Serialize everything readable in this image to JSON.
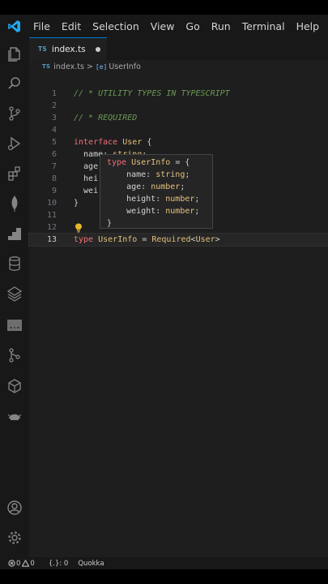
{
  "menubar": {
    "logo_icon": "vscode-logo-icon",
    "items": [
      "File",
      "Edit",
      "Selection",
      "View",
      "Go",
      "Run",
      "Terminal",
      "Help"
    ]
  },
  "activity_bar": {
    "top_icons": [
      "explorer-icon",
      "search-icon",
      "source-control-icon",
      "run-debug-icon",
      "extensions-icon",
      "mongodb-icon",
      "stairs-icon",
      "database-icon",
      "layers-icon",
      "env-icon",
      "git-graph-icon",
      "cube-icon",
      "remote-icon"
    ],
    "bottom_icons": [
      "account-icon",
      "settings-gear-icon"
    ]
  },
  "tab": {
    "badge": "TS",
    "filename": "index.ts",
    "dirty": true
  },
  "breadcrumb": {
    "badge": "TS",
    "file": "index.ts",
    "separator": ">",
    "symbol_glyph": "[e]",
    "symbol": "UserInfo"
  },
  "editor": {
    "active_line": 13,
    "lines": [
      {
        "n": "1",
        "tokens": [
          {
            "t": "// * UTILITY TYPES IN TYPESCRIPT",
            "c": "cm"
          }
        ]
      },
      {
        "n": "2",
        "tokens": []
      },
      {
        "n": "3",
        "tokens": [
          {
            "t": "// * REQUIRED",
            "c": "cm"
          }
        ]
      },
      {
        "n": "4",
        "tokens": []
      },
      {
        "n": "5",
        "tokens": [
          {
            "t": "interface",
            "c": "kw"
          },
          {
            "t": " ",
            "c": "pu"
          },
          {
            "t": "User",
            "c": "ty"
          },
          {
            "t": " {",
            "c": "pu"
          }
        ]
      },
      {
        "n": "6",
        "tokens": [
          {
            "t": "  name",
            "c": "pr"
          },
          {
            "t": ": ",
            "c": "pu"
          },
          {
            "t": "string",
            "c": "prim"
          },
          {
            "t": ";",
            "c": "pu"
          }
        ]
      },
      {
        "n": "7",
        "tokens": [
          {
            "t": "  age",
            "c": "pr"
          }
        ]
      },
      {
        "n": "8",
        "tokens": [
          {
            "t": "  hei",
            "c": "pr"
          }
        ]
      },
      {
        "n": "9",
        "tokens": [
          {
            "t": "  wei",
            "c": "pr"
          }
        ]
      },
      {
        "n": "10",
        "tokens": [
          {
            "t": "}",
            "c": "pu"
          }
        ]
      },
      {
        "n": "11",
        "tokens": []
      },
      {
        "n": "12",
        "tokens": []
      },
      {
        "n": "13",
        "tokens": [
          {
            "t": "type",
            "c": "kw"
          },
          {
            "t": " ",
            "c": "pu"
          },
          {
            "t": "UserInfo",
            "c": "ty"
          },
          {
            "t": " = ",
            "c": "pu"
          },
          {
            "t": "Required",
            "c": "ty"
          },
          {
            "t": "<",
            "c": "pu"
          },
          {
            "t": "User",
            "c": "ty"
          },
          {
            "t": ">",
            "c": "pu"
          }
        ]
      }
    ]
  },
  "hover_popup": {
    "lines": [
      [
        {
          "t": "type",
          "c": "kw"
        },
        {
          "t": " ",
          "c": "pu"
        },
        {
          "t": "UserInfo",
          "c": "ty"
        },
        {
          "t": " = {",
          "c": "pu"
        }
      ],
      [
        {
          "t": "    name",
          "c": "pr"
        },
        {
          "t": ": ",
          "c": "pu"
        },
        {
          "t": "string",
          "c": "prim"
        },
        {
          "t": ";",
          "c": "pu"
        }
      ],
      [
        {
          "t": "    age",
          "c": "pr"
        },
        {
          "t": ": ",
          "c": "pu"
        },
        {
          "t": "number",
          "c": "prim"
        },
        {
          "t": ";",
          "c": "pu"
        }
      ],
      [
        {
          "t": "    height",
          "c": "pr"
        },
        {
          "t": ": ",
          "c": "pu"
        },
        {
          "t": "number",
          "c": "prim"
        },
        {
          "t": ";",
          "c": "pu"
        }
      ],
      [
        {
          "t": "    weight",
          "c": "pr"
        },
        {
          "t": ": ",
          "c": "pu"
        },
        {
          "t": "number",
          "c": "prim"
        },
        {
          "t": ";",
          "c": "pu"
        }
      ],
      [
        {
          "t": "}",
          "c": "pu"
        }
      ]
    ]
  },
  "lightbulb_icon": "lightbulb-icon",
  "statusbar": {
    "errors": "0",
    "warnings": "0",
    "braces": "{.}: 0",
    "extension": "Quokka"
  },
  "colors": {
    "accent": "#0078d4",
    "background": "#1e1e1e",
    "chrome": "#181818",
    "keyword": "#f07178",
    "type": "#e5c07b",
    "comment": "#6a9955"
  }
}
